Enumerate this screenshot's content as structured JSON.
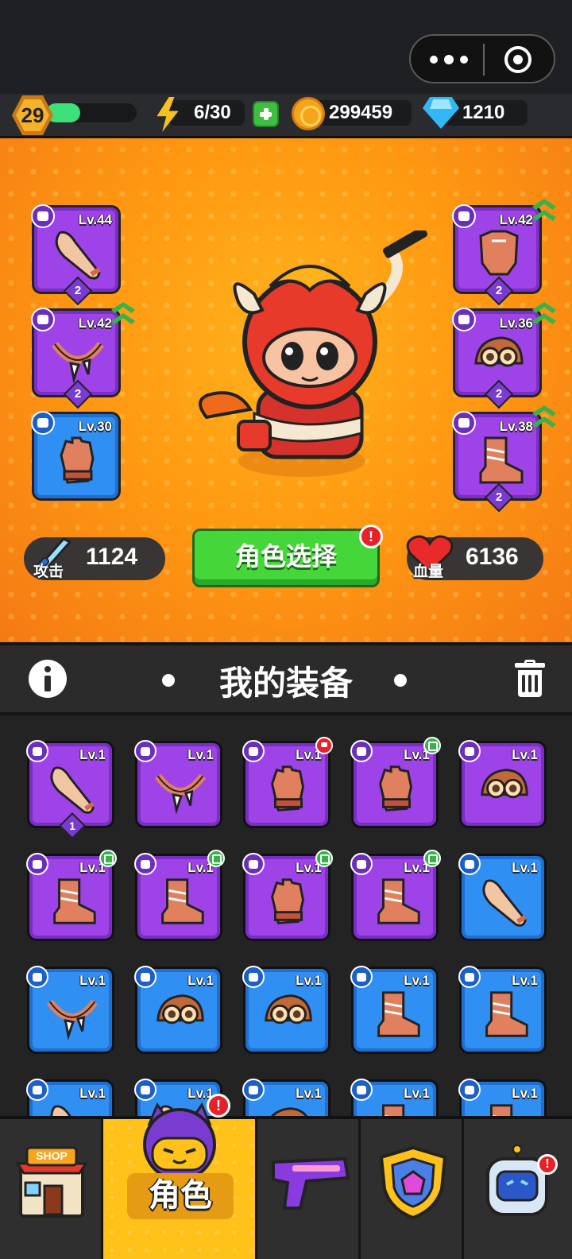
{
  "player": {
    "level": "29",
    "xp_fraction": 0.38
  },
  "resources": {
    "energy": "6/30",
    "gold": "299459",
    "diamonds": "1210"
  },
  "hero": {
    "equipped_left": [
      {
        "type": "weapon",
        "level": "Lv.44",
        "count": "2",
        "rarity": "purple",
        "upgradable": false
      },
      {
        "type": "necklace",
        "level": "Lv.42",
        "count": "2",
        "rarity": "purple",
        "upgradable": true
      },
      {
        "type": "gloves",
        "level": "Lv.30",
        "count": "",
        "rarity": "blue",
        "upgradable": false
      }
    ],
    "equipped_right": [
      {
        "type": "armor",
        "level": "Lv.42",
        "count": "2",
        "rarity": "purple",
        "upgradable": true
      },
      {
        "type": "helmet",
        "level": "Lv.36",
        "count": "2",
        "rarity": "purple",
        "upgradable": true
      },
      {
        "type": "boots",
        "level": "Lv.38",
        "count": "2",
        "rarity": "purple",
        "upgradable": true
      }
    ],
    "attack_label": "攻击",
    "attack_value": "1124",
    "hp_label": "血量",
    "hp_value": "6136",
    "select_button": "角色选择",
    "alert": "!"
  },
  "equipment": {
    "title": "我的装备",
    "items": [
      {
        "type": "weapon",
        "level": "Lv.1",
        "rarity": "purple",
        "count": "1",
        "flag": ""
      },
      {
        "type": "necklace",
        "level": "Lv.1",
        "rarity": "purple",
        "count": "",
        "flag": ""
      },
      {
        "type": "gloves",
        "level": "Lv.1",
        "rarity": "purple",
        "count": "",
        "flag": "red"
      },
      {
        "type": "gloves",
        "level": "Lv.1",
        "rarity": "purple",
        "count": "",
        "flag": "green"
      },
      {
        "type": "helmet",
        "level": "Lv.1",
        "rarity": "purple",
        "count": "",
        "flag": ""
      },
      {
        "type": "boots",
        "level": "Lv.1",
        "rarity": "purple",
        "count": "",
        "flag": "green"
      },
      {
        "type": "boots",
        "level": "Lv.1",
        "rarity": "purple",
        "count": "",
        "flag": "green"
      },
      {
        "type": "gloves",
        "level": "Lv.1",
        "rarity": "purple",
        "count": "",
        "flag": "green"
      },
      {
        "type": "boots",
        "level": "Lv.1",
        "rarity": "purple",
        "count": "",
        "flag": "green"
      },
      {
        "type": "weapon",
        "level": "Lv.1",
        "rarity": "blue",
        "count": "",
        "flag": ""
      },
      {
        "type": "necklace",
        "level": "Lv.1",
        "rarity": "blue",
        "count": "",
        "flag": ""
      },
      {
        "type": "helmet",
        "level": "Lv.1",
        "rarity": "blue",
        "count": "",
        "flag": ""
      },
      {
        "type": "helmet",
        "level": "Lv.1",
        "rarity": "blue",
        "count": "",
        "flag": ""
      },
      {
        "type": "boots",
        "level": "Lv.1",
        "rarity": "blue",
        "count": "",
        "flag": ""
      },
      {
        "type": "boots",
        "level": "Lv.1",
        "rarity": "blue",
        "count": "",
        "flag": ""
      },
      {
        "type": "weapon",
        "level": "Lv.1",
        "rarity": "blue",
        "count": "",
        "flag": ""
      },
      {
        "type": "weapon",
        "level": "Lv.1",
        "rarity": "blue",
        "count": "",
        "flag": ""
      },
      {
        "type": "helmet",
        "level": "Lv.1",
        "rarity": "blue",
        "count": "",
        "flag": ""
      },
      {
        "type": "boots",
        "level": "Lv.1",
        "rarity": "blue",
        "count": "",
        "flag": ""
      },
      {
        "type": "boots",
        "level": "Lv.1",
        "rarity": "blue",
        "count": "",
        "flag": ""
      }
    ]
  },
  "nav": {
    "shop_sign": "SHOP",
    "role_label": "角色",
    "role_alert": "!",
    "pets_alert": "!"
  },
  "colors": {
    "purple_rarity": "#9d43e8",
    "blue_rarity": "#2f8ff2",
    "accent_green": "#45d63a",
    "nav_active": "#ffc21a"
  }
}
